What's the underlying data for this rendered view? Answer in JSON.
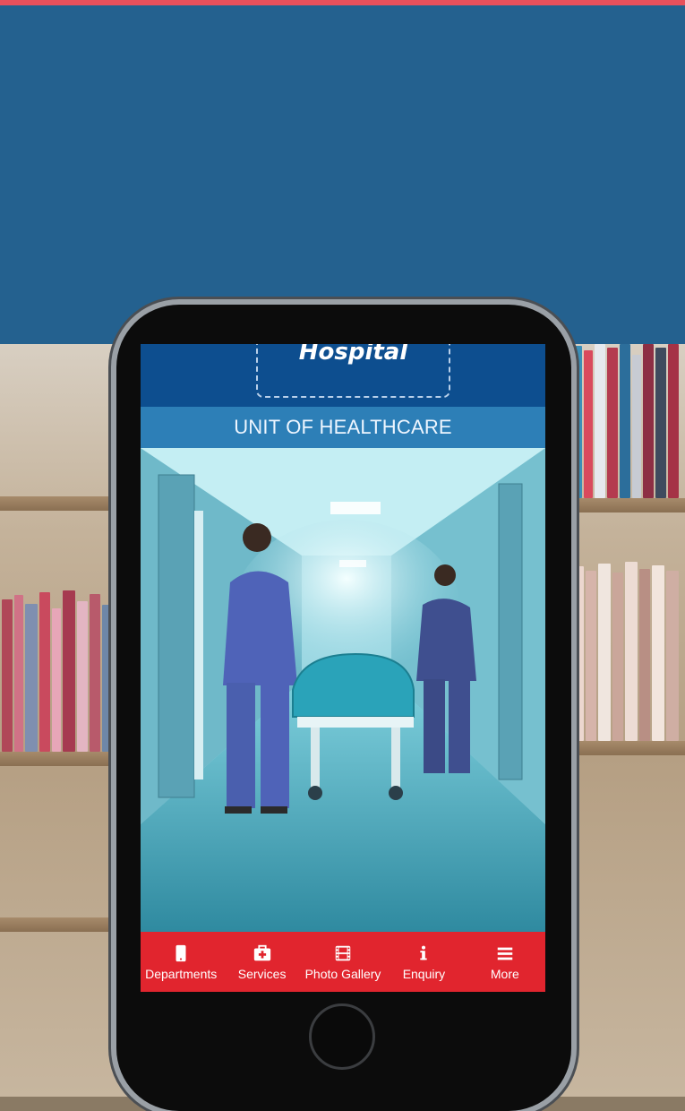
{
  "banner": {
    "color": "#24618f"
  },
  "app": {
    "logo_text": "Hospital",
    "subtitle": "UNIT OF HEALTHCARE"
  },
  "bottom_nav": [
    {
      "label": "Departments",
      "icon": "tablet-icon"
    },
    {
      "label": "Services",
      "icon": "medical-kit-icon"
    },
    {
      "label": "Photo Gallery",
      "icon": "film-icon"
    },
    {
      "label": "Enquiry",
      "icon": "info-icon"
    },
    {
      "label": "More",
      "icon": "menu-icon"
    }
  ],
  "colors": {
    "accent_top": "#e8505c",
    "app_header": "#0d4e8f",
    "subtitle_bar": "#2d7fb7",
    "nav_bar": "#e1252e"
  }
}
